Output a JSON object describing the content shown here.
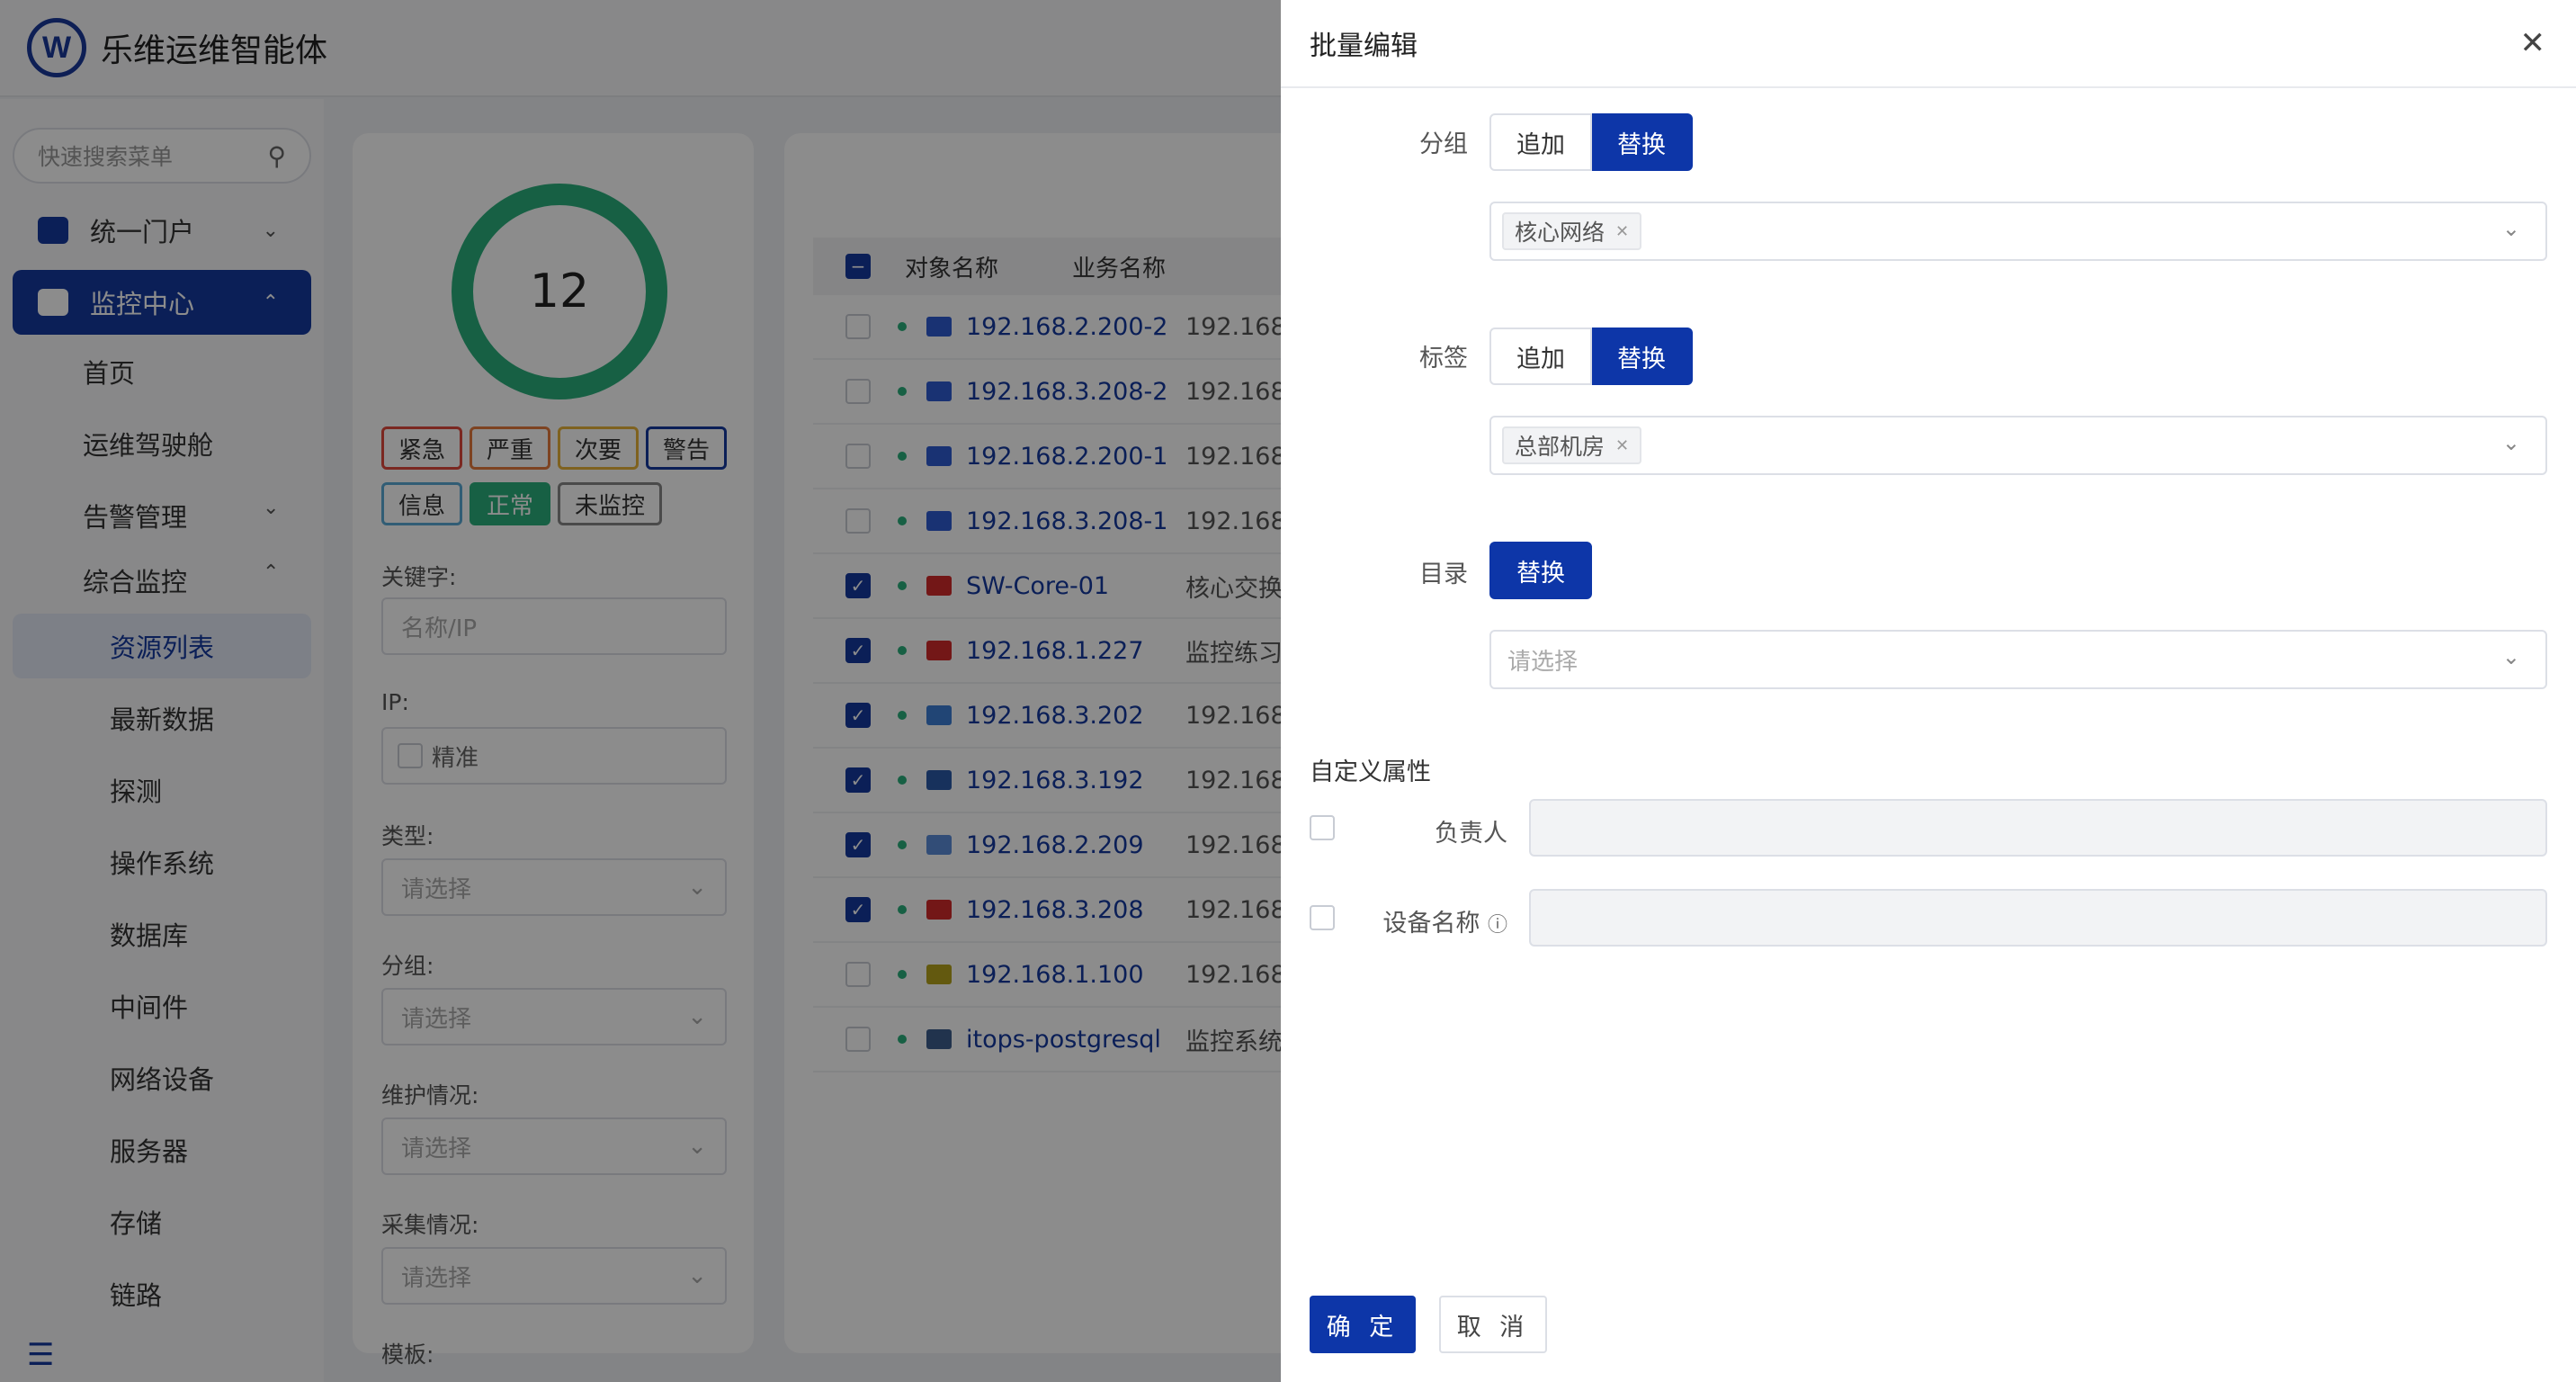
{
  "app": {
    "title": "乐维运维智能体",
    "logo_letter": "W"
  },
  "sidebar": {
    "search_placeholder": "快速搜索菜单",
    "top_items": [
      {
        "label": "统一门户",
        "icon": "home-icon"
      },
      {
        "label": "监控中心",
        "icon": "monitor-icon"
      }
    ],
    "sub_items": [
      "首页",
      "运维驾驶舱",
      "告警管理",
      "综合监控"
    ],
    "leaf_items": [
      "资源列表",
      "最新数据",
      "探测",
      "操作系统",
      "数据库",
      "中间件",
      "网络设备",
      "服务器",
      "存储",
      "链路"
    ]
  },
  "filter": {
    "ring_count": "12",
    "severity_tags": [
      {
        "label": "紧急",
        "color": "#e0493c"
      },
      {
        "label": "严重",
        "color": "#e67a3c"
      },
      {
        "label": "次要",
        "color": "#e8b23a"
      },
      {
        "label": "警告",
        "color": "#14399f"
      },
      {
        "label": "信息",
        "color": "#5aa9d6"
      },
      {
        "label": "正常",
        "color": "#2bb07c"
      },
      {
        "label": "未监控",
        "color": "#888888"
      }
    ],
    "keyword_label": "关键字:",
    "keyword_placeholder": "名称/IP",
    "ip_label": "IP:",
    "ip_exact_label": "精准",
    "type_label": "类型:",
    "group_label": "分组:",
    "maint_label": "维护情况:",
    "collect_label": "采集情况:",
    "template_label": "模板:",
    "select_placeholder": "请选择"
  },
  "table": {
    "headers": [
      "对象名称",
      "业务名称"
    ],
    "rows": [
      {
        "name": "192.168.2.200-2",
        "biz": "192.168.",
        "checked": false,
        "icon_color": "#2f5bd1"
      },
      {
        "name": "192.168.3.208-2",
        "biz": "192.168.",
        "checked": false,
        "icon_color": "#2f5bd1"
      },
      {
        "name": "192.168.2.200-1",
        "biz": "192.168.",
        "checked": false,
        "icon_color": "#2f5bd1"
      },
      {
        "name": "192.168.3.208-1",
        "biz": "192.168.",
        "checked": false,
        "icon_color": "#2f5bd1"
      },
      {
        "name": "SW-Core-01",
        "biz": "核心交换",
        "checked": true,
        "icon_color": "#d22b2b"
      },
      {
        "name": "192.168.1.227",
        "biz": "监控练习",
        "checked": true,
        "icon_color": "#d22b2b"
      },
      {
        "name": "192.168.3.202",
        "biz": "192.168.",
        "checked": true,
        "icon_color": "#3d7fd6"
      },
      {
        "name": "192.168.3.192",
        "biz": "192.168.",
        "checked": true,
        "icon_color": "#2a5aa8"
      },
      {
        "name": "192.168.2.209",
        "biz": "192.168.",
        "checked": true,
        "icon_color": "#5b8dd9"
      },
      {
        "name": "192.168.3.208",
        "biz": "192.168.",
        "checked": true,
        "icon_color": "#d22b2b"
      },
      {
        "name": "192.168.1.100",
        "biz": "192.168.",
        "checked": false,
        "icon_color": "#b5a21c"
      },
      {
        "name": "itops-postgresql",
        "biz": "监控系统",
        "checked": false,
        "icon_color": "#3c5e8c"
      }
    ]
  },
  "drawer": {
    "title": "批量编辑",
    "group": {
      "label": "分组",
      "append": "追加",
      "replace": "替换",
      "chip": "核心网络"
    },
    "tag": {
      "label": "标签",
      "append": "追加",
      "replace": "替换",
      "chip": "总部机房"
    },
    "catalog": {
      "label": "目录",
      "replace": "替换",
      "placeholder": "请选择"
    },
    "custom_attrs_title": "自定义属性",
    "attrs": [
      {
        "label": "负责人"
      },
      {
        "label": "设备名称"
      }
    ],
    "info_icon": "ⓘ",
    "ok": "确 定",
    "cancel": "取 消"
  }
}
